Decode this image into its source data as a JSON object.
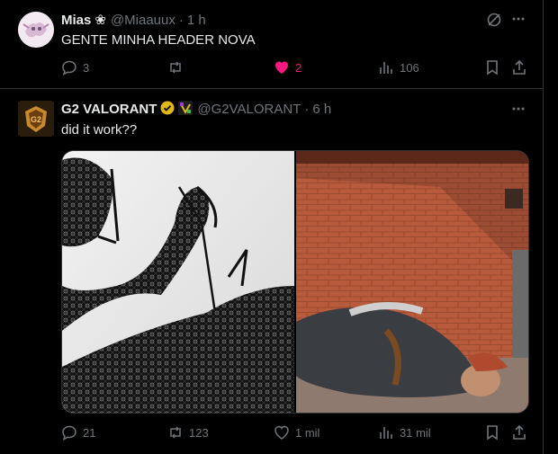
{
  "tweets": [
    {
      "name": "Mias",
      "badge": "❀",
      "handle": "@Miaauux",
      "time": "1 h",
      "text": "GENTE MINHA HEADER NOVA",
      "replies": "3",
      "retweets": "",
      "likes": "2",
      "views": "106"
    },
    {
      "name": "G2 VALORANT",
      "handle": "@G2VALORANT",
      "time": "6 h",
      "text": "did it work??",
      "replies": "21",
      "retweets": "123",
      "likes": "1 mil",
      "views": "31 mil"
    }
  ],
  "colors": {
    "like": "#f91880",
    "verified": "#e2b719",
    "muted": "#71767b"
  }
}
